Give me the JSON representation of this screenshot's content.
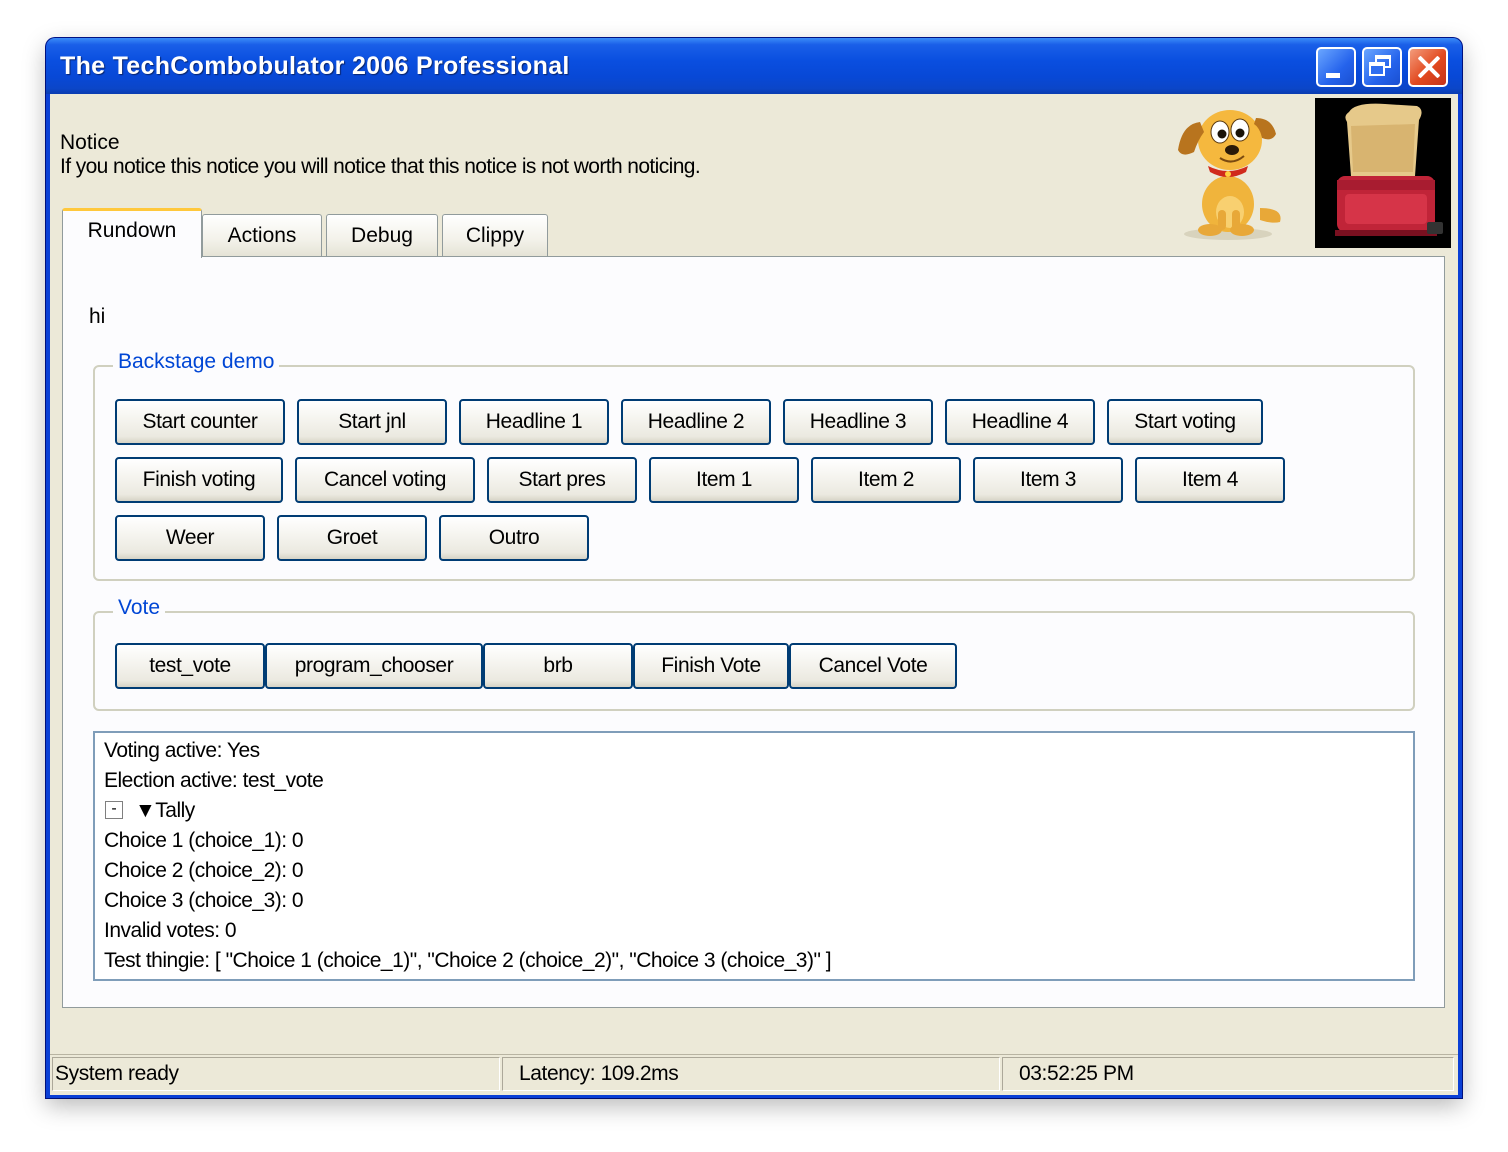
{
  "window": {
    "title": "The TechCombobulator 2006 Professional"
  },
  "notice": {
    "title": "Notice",
    "body": "If you notice this notice you will notice that this notice is not worth noticing."
  },
  "tabs": [
    {
      "label": "Rundown",
      "active": true
    },
    {
      "label": "Actions",
      "active": false
    },
    {
      "label": "Debug",
      "active": false
    },
    {
      "label": "Clippy",
      "active": false
    }
  ],
  "rundown": {
    "greeting": "hi",
    "backstage": {
      "legend": "Backstage demo",
      "buttons": [
        "Start counter",
        "Start jnl",
        "Headline 1",
        "Headline 2",
        "Headline 3",
        "Headline 4",
        "Start voting",
        "Finish voting",
        "Cancel voting",
        "Start pres",
        "Item 1",
        "Item 2",
        "Item 3",
        "Item 4",
        "Weer",
        "Groet",
        "Outro"
      ]
    },
    "vote": {
      "legend": "Vote",
      "buttons": [
        "test_vote",
        "program_chooser",
        "brb",
        "Finish Vote",
        "Cancel Vote"
      ]
    },
    "status": {
      "voting_active": "Voting active: Yes",
      "election_active": "Election active: test_vote",
      "tree_toggle": "-",
      "tally": "▼Tally",
      "choice_1": "Choice 1 (choice_1): 0",
      "choice_2": "Choice 2 (choice_2): 0",
      "choice_3": "Choice 3 (choice_3): 0",
      "invalid": "Invalid votes: 0",
      "test_thingie": "Test thingie: [ \"Choice 1 (choice_1)\", \"Choice 2 (choice_2)\", \"Choice 3 (choice_3)\" ]"
    }
  },
  "statusbar": {
    "state": "System ready",
    "latency": "Latency: 109.2ms",
    "time": "03:52:25 PM"
  },
  "colors": {
    "titlebar": "#0a4fe0",
    "client_bg": "#ece9d8",
    "legend_text": "#0046d5",
    "button_border": "#003c74",
    "active_tab_accent": "#ffc83c"
  },
  "icons": {
    "minimize": "minimize-icon",
    "maximize": "restore-icon",
    "close": "close-icon",
    "mascot": "dog-mascot-icon",
    "toaster": "toaster-icon"
  }
}
